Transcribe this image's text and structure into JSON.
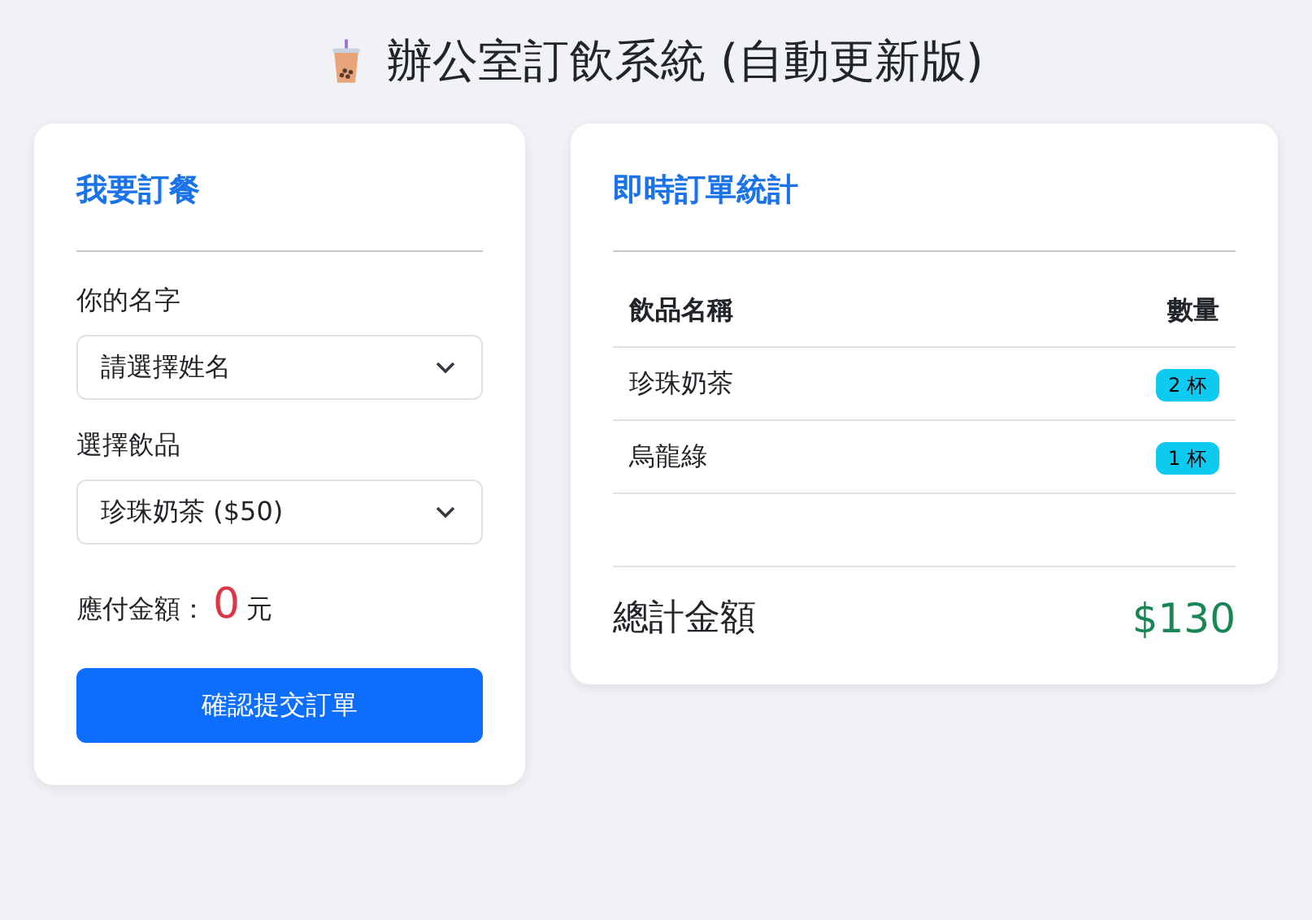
{
  "title": "辦公室訂飲系統 (自動更新版)",
  "order_form": {
    "heading": "我要訂餐",
    "name_label": "你的名字",
    "name_select": {
      "value": "請選擇姓名"
    },
    "drink_label": "選擇飲品",
    "drink_select": {
      "value": "珍珠奶茶 ($50)"
    },
    "amount_label": "應付金額：",
    "amount": "0",
    "amount_unit": "元",
    "submit_button": "確認提交訂單"
  },
  "stats": {
    "heading": "即時訂單統計",
    "table": {
      "columns": [
        "飲品名稱",
        "數量"
      ],
      "rows": [
        {
          "name": "珍珠奶茶",
          "count": "2 杯"
        },
        {
          "name": "烏龍綠",
          "count": "1 杯"
        }
      ]
    },
    "total_label": "總計金額",
    "total": "$130"
  }
}
